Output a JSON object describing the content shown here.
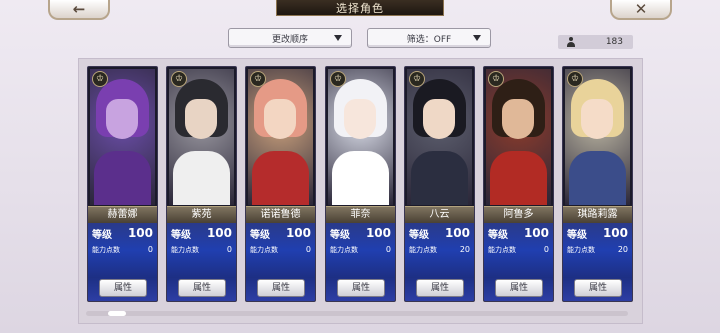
{
  "header": {
    "title": "选择角色",
    "back_glyph": "←",
    "close_glyph": "✕"
  },
  "toolbar": {
    "sort_label": "更改顺序",
    "filter_label": "筛选：OFF",
    "character_count": "183"
  },
  "labels": {
    "level": "等级",
    "ability_points": "能力点数",
    "attribute_button": "属性"
  },
  "characters": [
    {
      "name": "赫蕾娜",
      "level": "100",
      "ability_points": "0",
      "colors": {
        "bg": "#6b4ea8",
        "hair": "#7a3fb0",
        "face": "#c8a3e0",
        "body": "#5b2f8c"
      }
    },
    {
      "name": "紫苑",
      "level": "100",
      "ability_points": "0",
      "colors": {
        "bg": "#9a98a0",
        "hair": "#2a2a30",
        "face": "#e8d4c4",
        "body": "#efefef"
      }
    },
    {
      "name": "诺诺鲁德",
      "level": "100",
      "ability_points": "0",
      "colors": {
        "bg": "#c9a07c",
        "hair": "#e59a86",
        "face": "#f3d6c2",
        "body": "#b52c2c"
      }
    },
    {
      "name": "菲奈",
      "level": "100",
      "ability_points": "0",
      "colors": {
        "bg": "#d8dbe6",
        "hair": "#f2f2f6",
        "face": "#f7e6dc",
        "body": "#ffffff"
      }
    },
    {
      "name": "八云",
      "level": "100",
      "ability_points": "20",
      "colors": {
        "bg": "#5d5f6e",
        "hair": "#1a1a22",
        "face": "#efd8c6",
        "body": "#2b2e40"
      }
    },
    {
      "name": "阿鲁多",
      "level": "100",
      "ability_points": "0",
      "colors": {
        "bg": "#8c3c2c",
        "hair": "#2e1f16",
        "face": "#e0b898",
        "body": "#b22b24"
      }
    },
    {
      "name": "琪路莉露",
      "level": "100",
      "ability_points": "20",
      "colors": {
        "bg": "#b9b3a0",
        "hair": "#e9d39a",
        "face": "#f5dcc8",
        "body": "#3b4d8a"
      }
    }
  ],
  "badge_glyph": "♔"
}
